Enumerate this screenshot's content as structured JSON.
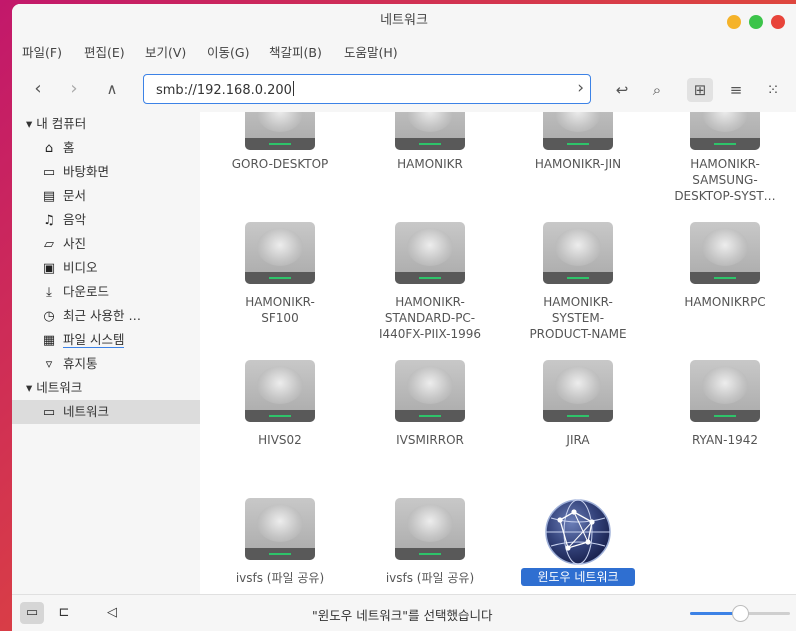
{
  "window": {
    "title": "네트워크"
  },
  "menu": [
    "파일(F)",
    "편집(E)",
    "보기(V)",
    "이동(G)",
    "책갈피(B)",
    "도움말(H)"
  ],
  "location": {
    "path": "smb://192.168.0.200"
  },
  "sidebar": {
    "sections": [
      {
        "label": "내 컴퓨터",
        "items": [
          {
            "label": "홈",
            "icon": "home-icon"
          },
          {
            "label": "바탕화면",
            "icon": "desktop-icon"
          },
          {
            "label": "문서",
            "icon": "document-icon"
          },
          {
            "label": "음악",
            "icon": "music-icon"
          },
          {
            "label": "사진",
            "icon": "picture-icon"
          },
          {
            "label": "비디오",
            "icon": "video-icon"
          },
          {
            "label": "다운로드",
            "icon": "download-icon"
          },
          {
            "label": "최근 사용한 …",
            "icon": "recent-icon"
          },
          {
            "label": "파일 시스템",
            "icon": "drive-icon"
          },
          {
            "label": "휴지통",
            "icon": "trash-icon"
          }
        ]
      },
      {
        "label": "네트워크",
        "items": [
          {
            "label": "네트워크",
            "icon": "network-icon",
            "selected": true
          }
        ]
      }
    ]
  },
  "items": [
    {
      "label": "GORO-DESKTOP",
      "type": "share"
    },
    {
      "label": "HAMONIKR",
      "type": "share"
    },
    {
      "label": "HAMONIKR-JIN",
      "type": "share"
    },
    {
      "label": "HAMONIKR-\nSAMSUNG-\nDESKTOP-SYST…",
      "type": "share"
    },
    {
      "label": "HAMONIKR-\nSF100",
      "type": "share"
    },
    {
      "label": "HAMONIKR-\nSTANDARD-PC-\nI440FX-PIIX-1996",
      "type": "share"
    },
    {
      "label": "HAMONIKR-\nSYSTEM-\nPRODUCT-NAME",
      "type": "share"
    },
    {
      "label": "HAMONIKRPC",
      "type": "share"
    },
    {
      "label": "HIVS02",
      "type": "share"
    },
    {
      "label": "IVSMIRROR",
      "type": "share"
    },
    {
      "label": "JIRA",
      "type": "share"
    },
    {
      "label": "RYAN-1942",
      "type": "share"
    },
    {
      "label": "ivsfs (파일 공유)",
      "type": "share"
    },
    {
      "label": "ivsfs (파일 공유)",
      "type": "share"
    },
    {
      "label": "윈도우 네트워크",
      "type": "network",
      "selected": true
    }
  ],
  "status": {
    "text": "\"윈도우 네트워크\"를 선택했습니다",
    "zoom_percent": 50
  }
}
